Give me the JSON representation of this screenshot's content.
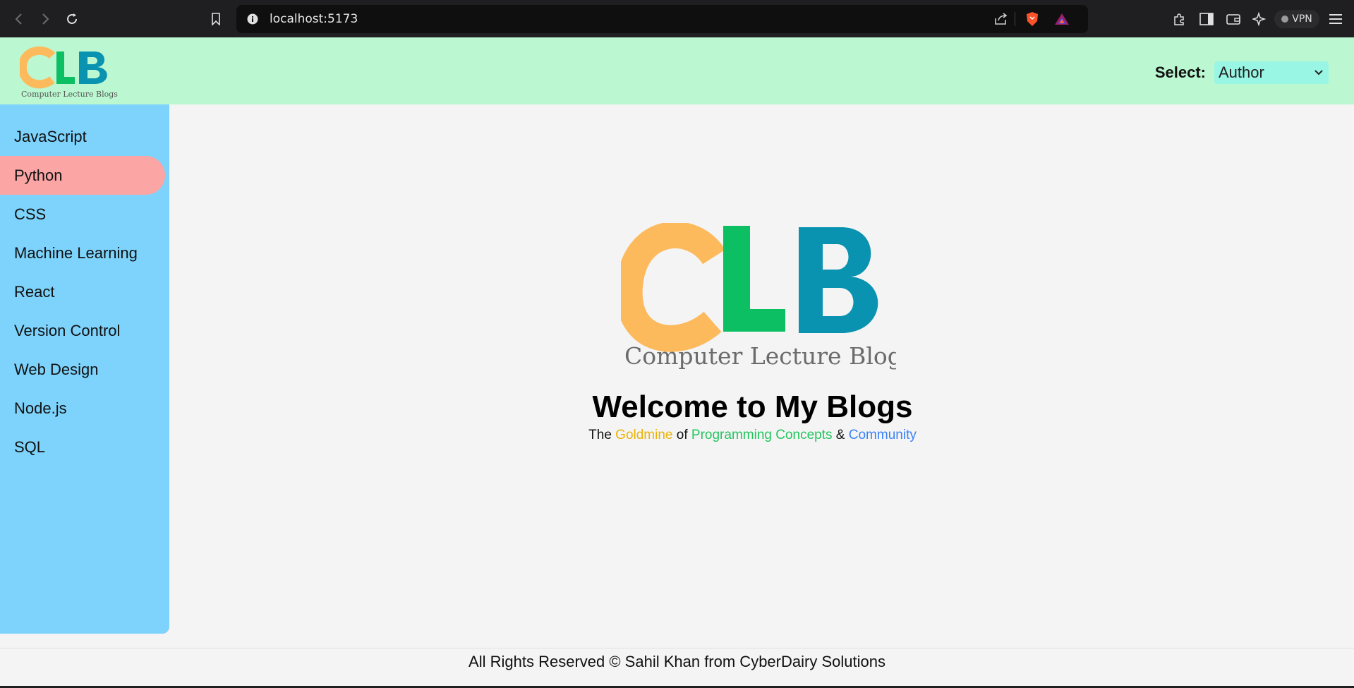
{
  "browser": {
    "url": "localhost:5173",
    "vpn_label": "VPN"
  },
  "header": {
    "logo_text": "CLB",
    "logo_subtitle": "Computer Lecture Blogs",
    "select_label": "Select:",
    "select_value": "Author"
  },
  "sidebar": {
    "items": [
      {
        "label": "JavaScript",
        "active": false
      },
      {
        "label": "Python",
        "active": true
      },
      {
        "label": "CSS",
        "active": false
      },
      {
        "label": "Machine Learning",
        "active": false
      },
      {
        "label": "React",
        "active": false
      },
      {
        "label": "Version Control",
        "active": false
      },
      {
        "label": "Web Design",
        "active": false
      },
      {
        "label": "Node.js",
        "active": false
      },
      {
        "label": "SQL",
        "active": false
      }
    ]
  },
  "main": {
    "logo_text": "CLB",
    "logo_subtitle": "Computer Lecture Blogs",
    "welcome": "Welcome to My Blogs",
    "tagline": {
      "the": "The",
      "goldmine": "Goldmine",
      "of": "of",
      "concepts": "Programming Concepts",
      "amp": "&",
      "community": "Community"
    }
  },
  "footer": {
    "text": "All Rights Reserved © Sahil Khan from CyberDairy Solutions"
  },
  "colors": {
    "header_bg": "#bbf7d0",
    "sidebar_bg": "#7dd3fc",
    "active_item": "#fca5a5",
    "select_bg": "#99f6e4",
    "logo_c": "#fdba5c",
    "logo_l": "#0bbf62",
    "logo_b": "#0993b0",
    "goldmine": "#eab308",
    "concepts": "#22c55e",
    "community": "#3b82f6"
  }
}
